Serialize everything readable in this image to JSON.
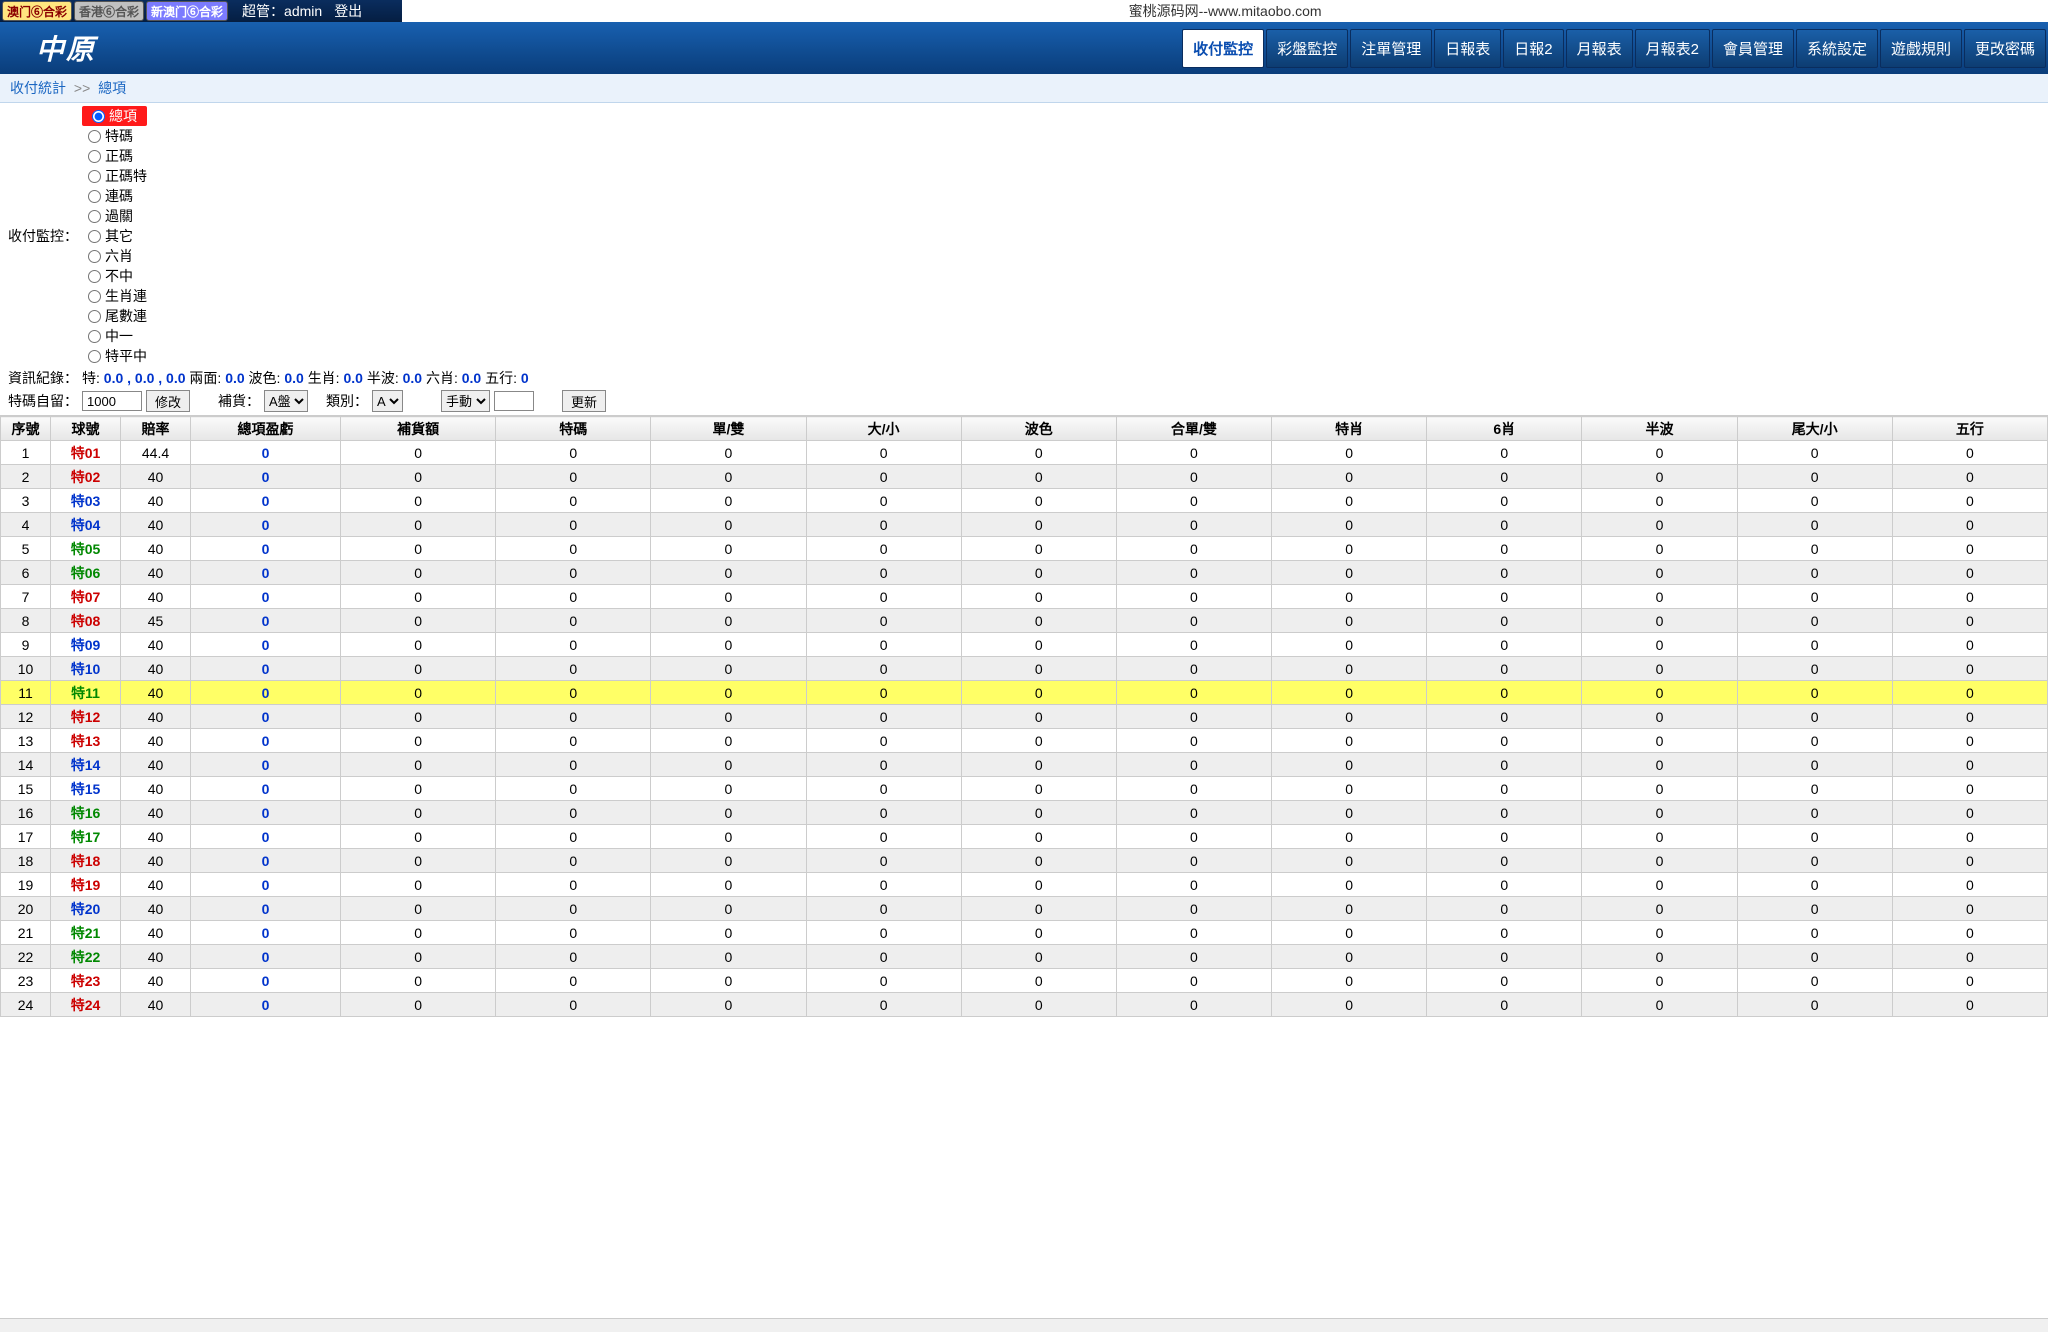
{
  "top": {
    "tabs": [
      "澳门⑥合彩",
      "香港⑥合彩",
      "新澳门⑥合彩"
    ],
    "admin_label": "超管：admin",
    "logout": "登出",
    "url": "蜜桃源码网--www.mitaobo.com"
  },
  "brand": "中原",
  "nav": [
    {
      "label": "收付監控",
      "active": true
    },
    {
      "label": "彩盤監控"
    },
    {
      "label": "注單管理"
    },
    {
      "label": "日報表"
    },
    {
      "label": "日報2"
    },
    {
      "label": "月報表"
    },
    {
      "label": "月報表2"
    },
    {
      "label": "會員管理"
    },
    {
      "label": "系統設定"
    },
    {
      "label": "遊戲規則"
    },
    {
      "label": "更改密碼"
    }
  ],
  "crumb": {
    "a": "收付統計",
    "sep": ">>",
    "b": "總項"
  },
  "filters": {
    "label": "收付監控：",
    "radios": [
      "總項",
      "特碼",
      "正碼",
      "正碼特",
      "連碼",
      "過關",
      "其它",
      "六肖",
      "不中",
      "生肖連",
      "尾數連",
      "中一",
      "特平中"
    ],
    "info_label": "資訊紀錄：",
    "info_items": [
      {
        "k": "特:",
        "v": "0.0 , 0.0 , 0.0"
      },
      {
        "k": "兩面:",
        "v": "0.0"
      },
      {
        "k": "波色:",
        "v": "0.0"
      },
      {
        "k": "生肖:",
        "v": "0.0"
      },
      {
        "k": "半波:",
        "v": "0.0"
      },
      {
        "k": "六肖:",
        "v": "0.0"
      },
      {
        "k": "五行:",
        "v": "0"
      }
    ],
    "keep_label": "特碼自留：",
    "keep_value": "1000",
    "modify": "修改",
    "restock_label": "補貨：",
    "restock_sel": "A盤",
    "type_label": "類別：",
    "type_sel": "A",
    "mode_sel": "手動",
    "update": "更新"
  },
  "table": {
    "headers": [
      "序號",
      "球號",
      "賠率",
      "總項盈虧",
      "補貨額",
      "特碼",
      "單/雙",
      "大/小",
      "波色",
      "合單/雙",
      "特肖",
      "6肖",
      "半波",
      "尾大/小",
      "五行"
    ],
    "highlight_row": 11,
    "rows": [
      {
        "n": 1,
        "ball": "特01",
        "cls": "red",
        "rate": "44.4",
        "vals": [
          "0",
          "0",
          "0",
          "0",
          "0",
          "0",
          "0",
          "0",
          "0",
          "0",
          "0",
          "0"
        ]
      },
      {
        "n": 2,
        "ball": "特02",
        "cls": "red",
        "rate": "40",
        "vals": [
          "0",
          "0",
          "0",
          "0",
          "0",
          "0",
          "0",
          "0",
          "0",
          "0",
          "0",
          "0"
        ]
      },
      {
        "n": 3,
        "ball": "特03",
        "cls": "blue",
        "rate": "40",
        "vals": [
          "0",
          "0",
          "0",
          "0",
          "0",
          "0",
          "0",
          "0",
          "0",
          "0",
          "0",
          "0"
        ]
      },
      {
        "n": 4,
        "ball": "特04",
        "cls": "blue",
        "rate": "40",
        "vals": [
          "0",
          "0",
          "0",
          "0",
          "0",
          "0",
          "0",
          "0",
          "0",
          "0",
          "0",
          "0"
        ]
      },
      {
        "n": 5,
        "ball": "特05",
        "cls": "green",
        "rate": "40",
        "vals": [
          "0",
          "0",
          "0",
          "0",
          "0",
          "0",
          "0",
          "0",
          "0",
          "0",
          "0",
          "0"
        ]
      },
      {
        "n": 6,
        "ball": "特06",
        "cls": "green",
        "rate": "40",
        "vals": [
          "0",
          "0",
          "0",
          "0",
          "0",
          "0",
          "0",
          "0",
          "0",
          "0",
          "0",
          "0"
        ]
      },
      {
        "n": 7,
        "ball": "特07",
        "cls": "red",
        "rate": "40",
        "vals": [
          "0",
          "0",
          "0",
          "0",
          "0",
          "0",
          "0",
          "0",
          "0",
          "0",
          "0",
          "0"
        ]
      },
      {
        "n": 8,
        "ball": "特08",
        "cls": "red",
        "rate": "45",
        "vals": [
          "0",
          "0",
          "0",
          "0",
          "0",
          "0",
          "0",
          "0",
          "0",
          "0",
          "0",
          "0"
        ]
      },
      {
        "n": 9,
        "ball": "特09",
        "cls": "blue",
        "rate": "40",
        "vals": [
          "0",
          "0",
          "0",
          "0",
          "0",
          "0",
          "0",
          "0",
          "0",
          "0",
          "0",
          "0"
        ]
      },
      {
        "n": 10,
        "ball": "特10",
        "cls": "blue",
        "rate": "40",
        "vals": [
          "0",
          "0",
          "0",
          "0",
          "0",
          "0",
          "0",
          "0",
          "0",
          "0",
          "0",
          "0"
        ]
      },
      {
        "n": 11,
        "ball": "特11",
        "cls": "green",
        "rate": "40",
        "vals": [
          "0",
          "0",
          "0",
          "0",
          "0",
          "0",
          "0",
          "0",
          "0",
          "0",
          "0",
          "0"
        ]
      },
      {
        "n": 12,
        "ball": "特12",
        "cls": "red",
        "rate": "40",
        "vals": [
          "0",
          "0",
          "0",
          "0",
          "0",
          "0",
          "0",
          "0",
          "0",
          "0",
          "0",
          "0"
        ]
      },
      {
        "n": 13,
        "ball": "特13",
        "cls": "red",
        "rate": "40",
        "vals": [
          "0",
          "0",
          "0",
          "0",
          "0",
          "0",
          "0",
          "0",
          "0",
          "0",
          "0",
          "0"
        ]
      },
      {
        "n": 14,
        "ball": "特14",
        "cls": "blue",
        "rate": "40",
        "vals": [
          "0",
          "0",
          "0",
          "0",
          "0",
          "0",
          "0",
          "0",
          "0",
          "0",
          "0",
          "0"
        ]
      },
      {
        "n": 15,
        "ball": "特15",
        "cls": "blue",
        "rate": "40",
        "vals": [
          "0",
          "0",
          "0",
          "0",
          "0",
          "0",
          "0",
          "0",
          "0",
          "0",
          "0",
          "0"
        ]
      },
      {
        "n": 16,
        "ball": "特16",
        "cls": "green",
        "rate": "40",
        "vals": [
          "0",
          "0",
          "0",
          "0",
          "0",
          "0",
          "0",
          "0",
          "0",
          "0",
          "0",
          "0"
        ]
      },
      {
        "n": 17,
        "ball": "特17",
        "cls": "green",
        "rate": "40",
        "vals": [
          "0",
          "0",
          "0",
          "0",
          "0",
          "0",
          "0",
          "0",
          "0",
          "0",
          "0",
          "0"
        ]
      },
      {
        "n": 18,
        "ball": "特18",
        "cls": "red",
        "rate": "40",
        "vals": [
          "0",
          "0",
          "0",
          "0",
          "0",
          "0",
          "0",
          "0",
          "0",
          "0",
          "0",
          "0"
        ]
      },
      {
        "n": 19,
        "ball": "特19",
        "cls": "red",
        "rate": "40",
        "vals": [
          "0",
          "0",
          "0",
          "0",
          "0",
          "0",
          "0",
          "0",
          "0",
          "0",
          "0",
          "0"
        ]
      },
      {
        "n": 20,
        "ball": "特20",
        "cls": "blue",
        "rate": "40",
        "vals": [
          "0",
          "0",
          "0",
          "0",
          "0",
          "0",
          "0",
          "0",
          "0",
          "0",
          "0",
          "0"
        ]
      },
      {
        "n": 21,
        "ball": "特21",
        "cls": "green",
        "rate": "40",
        "vals": [
          "0",
          "0",
          "0",
          "0",
          "0",
          "0",
          "0",
          "0",
          "0",
          "0",
          "0",
          "0"
        ]
      },
      {
        "n": 22,
        "ball": "特22",
        "cls": "green",
        "rate": "40",
        "vals": [
          "0",
          "0",
          "0",
          "0",
          "0",
          "0",
          "0",
          "0",
          "0",
          "0",
          "0",
          "0"
        ]
      },
      {
        "n": 23,
        "ball": "特23",
        "cls": "red",
        "rate": "40",
        "vals": [
          "0",
          "0",
          "0",
          "0",
          "0",
          "0",
          "0",
          "0",
          "0",
          "0",
          "0",
          "0"
        ]
      },
      {
        "n": 24,
        "ball": "特24",
        "cls": "red",
        "rate": "40",
        "vals": [
          "0",
          "0",
          "0",
          "0",
          "0",
          "0",
          "0",
          "0",
          "0",
          "0",
          "0",
          "0"
        ]
      }
    ]
  }
}
